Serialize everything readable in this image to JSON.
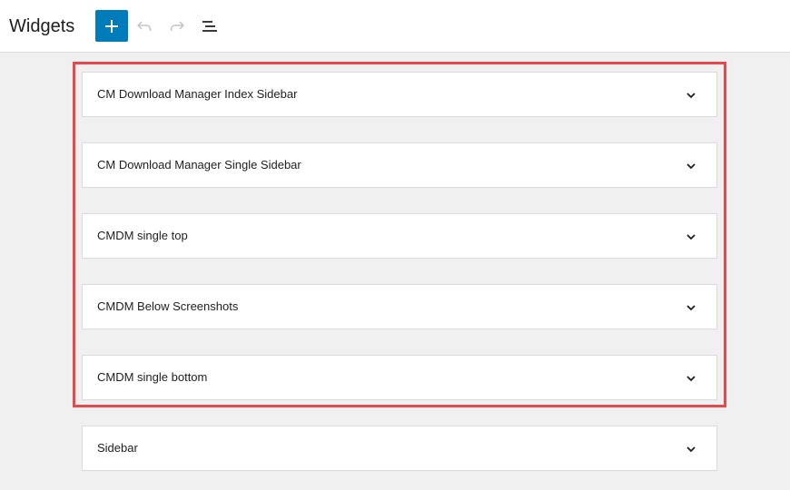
{
  "header": {
    "title": "Widgets",
    "add_label": "Add block",
    "undo_label": "Undo",
    "redo_label": "Redo",
    "list_view_label": "List View",
    "colors": {
      "accent": "#007cba",
      "highlight": "#e5484d",
      "disabled_icon": "#c3c4c7"
    }
  },
  "widget_areas": [
    {
      "title": "CM Download Manager Index Sidebar",
      "expanded": false,
      "icon": "chevron-down-icon"
    },
    {
      "title": "CM Download Manager Single Sidebar",
      "expanded": false,
      "icon": "chevron-down-icon"
    },
    {
      "title": "CMDM single top",
      "expanded": false,
      "icon": "chevron-down-icon"
    },
    {
      "title": "CMDM Below Screenshots",
      "expanded": false,
      "icon": "chevron-down-icon"
    },
    {
      "title": "CMDM single bottom",
      "expanded": false,
      "icon": "chevron-down-icon"
    },
    {
      "title": "Sidebar",
      "expanded": false,
      "icon": "chevron-down-icon"
    }
  ]
}
